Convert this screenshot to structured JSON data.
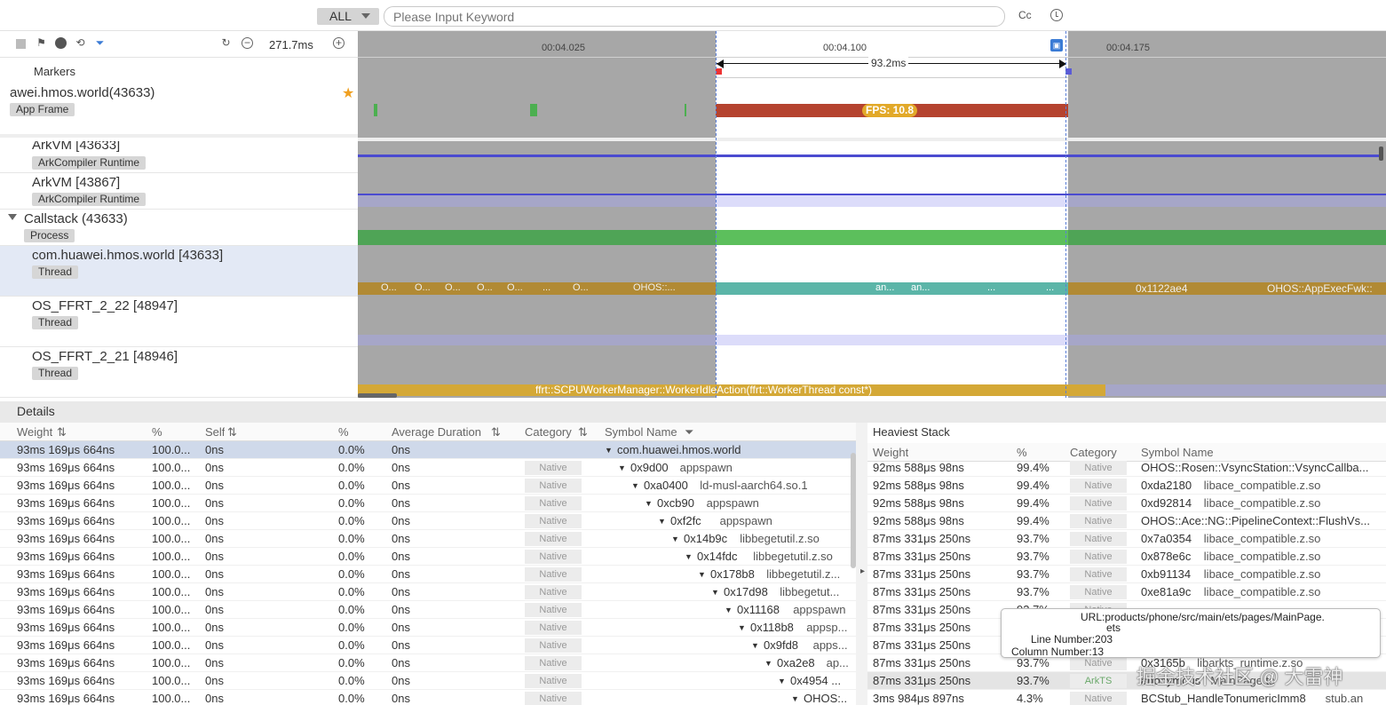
{
  "toolbar": {
    "filter_select": "ALL",
    "search_placeholder": "Please Input Keyword",
    "case_label": "Cc"
  },
  "left_toolbar": {
    "zoom_value": "271.7ms",
    "markers_label": "Markers"
  },
  "timeline": {
    "ticks": [
      "00:04.025",
      "00:04.100",
      "00:04.175"
    ],
    "selection_duration": "93.2ms",
    "fps_label": "FPS: 10.8",
    "thread_slices": [
      "O...",
      "O...",
      "O...",
      "O...",
      "O...",
      "...",
      "O...",
      "OHOS::...",
      "an...",
      "an...",
      "...",
      "...",
      "0x1122ae4",
      "OHOS::AppExecFwk::"
    ],
    "worker_slice": "ffrt::SCPUWorkerManager::WorkerIdleAction(ffrt::WorkerThread const*)"
  },
  "rows": [
    {
      "name": "awei.hmos.world(43633)",
      "tag": "App Frame"
    },
    {
      "name": "ArkVM [43633]",
      "tag": "ArkCompiler Runtime"
    },
    {
      "name": "ArkVM [43867]",
      "tag": "ArkCompiler Runtime"
    },
    {
      "name": "Callstack (43633)",
      "tag": "Process"
    },
    {
      "name": "com.huawei.hmos.world [43633]",
      "tag": "Thread"
    },
    {
      "name": "OS_FFRT_2_22 [48947]",
      "tag": "Thread"
    },
    {
      "name": "OS_FFRT_2_21 [48946]",
      "tag": "Thread"
    }
  ],
  "details": {
    "title": "Details",
    "columns": [
      "Weight",
      "%",
      "Self",
      "%",
      "Average Duration",
      "Category",
      "Symbol Name"
    ],
    "rows": [
      {
        "weight": "93ms 169μs 664ns",
        "pct": "100.0...",
        "self": "0ns",
        "spct": "0.0%",
        "avg": "0ns",
        "cat": "",
        "sym": "com.huawei.hmos.world",
        "lib": "",
        "indent": 0
      },
      {
        "weight": "93ms 169μs 664ns",
        "pct": "100.0...",
        "self": "0ns",
        "spct": "0.0%",
        "avg": "0ns",
        "cat": "Native",
        "sym": "0x9d00",
        "lib": "appspawn",
        "indent": 1
      },
      {
        "weight": "93ms 169μs 664ns",
        "pct": "100.0...",
        "self": "0ns",
        "spct": "0.0%",
        "avg": "0ns",
        "cat": "Native",
        "sym": "0xa0400",
        "lib": "ld-musl-aarch64.so.1",
        "indent": 2
      },
      {
        "weight": "93ms 169μs 664ns",
        "pct": "100.0...",
        "self": "0ns",
        "spct": "0.0%",
        "avg": "0ns",
        "cat": "Native",
        "sym": "0xcb90",
        "lib": "appspawn",
        "indent": 3
      },
      {
        "weight": "93ms 169μs 664ns",
        "pct": "100.0...",
        "self": "0ns",
        "spct": "0.0%",
        "avg": "0ns",
        "cat": "Native",
        "sym": "0xf2fc",
        "lib": "appspawn",
        "indent": 4
      },
      {
        "weight": "93ms 169μs 664ns",
        "pct": "100.0...",
        "self": "0ns",
        "spct": "0.0%",
        "avg": "0ns",
        "cat": "Native",
        "sym": "0x14b9c",
        "lib": "libbegetutil.z.so",
        "indent": 5
      },
      {
        "weight": "93ms 169μs 664ns",
        "pct": "100.0...",
        "self": "0ns",
        "spct": "0.0%",
        "avg": "0ns",
        "cat": "Native",
        "sym": "0x14fdc",
        "lib": "libbegetutil.z.so",
        "indent": 6
      },
      {
        "weight": "93ms 169μs 664ns",
        "pct": "100.0...",
        "self": "0ns",
        "spct": "0.0%",
        "avg": "0ns",
        "cat": "Native",
        "sym": "0x178b8",
        "lib": "libbegetutil.z...",
        "indent": 7
      },
      {
        "weight": "93ms 169μs 664ns",
        "pct": "100.0...",
        "self": "0ns",
        "spct": "0.0%",
        "avg": "0ns",
        "cat": "Native",
        "sym": "0x17d98",
        "lib": "libbegetut...",
        "indent": 8
      },
      {
        "weight": "93ms 169μs 664ns",
        "pct": "100.0...",
        "self": "0ns",
        "spct": "0.0%",
        "avg": "0ns",
        "cat": "Native",
        "sym": "0x11168",
        "lib": "appspawn",
        "indent": 9
      },
      {
        "weight": "93ms 169μs 664ns",
        "pct": "100.0...",
        "self": "0ns",
        "spct": "0.0%",
        "avg": "0ns",
        "cat": "Native",
        "sym": "0x118b8",
        "lib": "appsp...",
        "indent": 10
      },
      {
        "weight": "93ms 169μs 664ns",
        "pct": "100.0...",
        "self": "0ns",
        "spct": "0.0%",
        "avg": "0ns",
        "cat": "Native",
        "sym": "0x9fd8",
        "lib": "apps...",
        "indent": 11
      },
      {
        "weight": "93ms 169μs 664ns",
        "pct": "100.0...",
        "self": "0ns",
        "spct": "0.0%",
        "avg": "0ns",
        "cat": "Native",
        "sym": "0xa2e8",
        "lib": "ap...",
        "indent": 12
      },
      {
        "weight": "93ms 169μs 664ns",
        "pct": "100.0...",
        "self": "0ns",
        "spct": "0.0%",
        "avg": "0ns",
        "cat": "Native",
        "sym": "0x4954 ...",
        "lib": "",
        "indent": 13
      },
      {
        "weight": "93ms 169μs 664ns",
        "pct": "100.0...",
        "self": "0ns",
        "spct": "0.0%",
        "avg": "0ns",
        "cat": "Native",
        "sym": "OHOS:...",
        "lib": "",
        "indent": 14
      }
    ]
  },
  "heaviest": {
    "title": "Heaviest Stack",
    "columns": [
      "Weight",
      "%",
      "Category",
      "Symbol Name"
    ],
    "rows": [
      {
        "weight": "92ms 588μs 98ns",
        "pct": "99.4%",
        "cat": "Native",
        "sym": "OHOS::Rosen::VsyncStation::VsyncCallba...",
        "lib": ""
      },
      {
        "weight": "92ms 588μs 98ns",
        "pct": "99.4%",
        "cat": "Native",
        "sym": "0xda2180",
        "lib": "libace_compatible.z.so"
      },
      {
        "weight": "92ms 588μs 98ns",
        "pct": "99.4%",
        "cat": "Native",
        "sym": "0xd92814",
        "lib": "libace_compatible.z.so"
      },
      {
        "weight": "92ms 588μs 98ns",
        "pct": "99.4%",
        "cat": "Native",
        "sym": "OHOS::Ace::NG::PipelineContext::FlushVs...",
        "lib": ""
      },
      {
        "weight": "87ms 331μs 250ns",
        "pct": "93.7%",
        "cat": "Native",
        "sym": "0x7a0354",
        "lib": "libace_compatible.z.so"
      },
      {
        "weight": "87ms 331μs 250ns",
        "pct": "93.7%",
        "cat": "Native",
        "sym": "0x878e6c",
        "lib": "libace_compatible.z.so"
      },
      {
        "weight": "87ms 331μs 250ns",
        "pct": "93.7%",
        "cat": "Native",
        "sym": "0xb91134",
        "lib": "libace_compatible.z.so"
      },
      {
        "weight": "87ms 331μs 250ns",
        "pct": "93.7%",
        "cat": "Native",
        "sym": "0xe81a9c",
        "lib": "libace_compatible.z.so"
      },
      {
        "weight": "87ms 331μs 250ns",
        "pct": "93.7%",
        "cat": "Native",
        "sym": "",
        "lib": ""
      },
      {
        "weight": "87ms 331μs 250ns",
        "pct": "93.7%",
        "cat": "Native",
        "sym": "",
        "lib": ""
      },
      {
        "weight": "87ms 331μs 250ns",
        "pct": "93.7%",
        "cat": "Native",
        "sym": "",
        "lib": ""
      },
      {
        "weight": "87ms 331μs 250ns",
        "pct": "93.7%",
        "cat": "Native",
        "sym": "0x3165b",
        "lib": "libarkts_runtime.z.so"
      },
      {
        "weight": "87ms 331μs 250ns",
        "pct": "93.7%",
        "cat": "ArkTS",
        "sym": "anonymous",
        "lib": "MainPage.ts"
      },
      {
        "weight": "3ms 984μs 897ns",
        "pct": "4.3%",
        "cat": "Native",
        "sym": "BCStub_HandleTonumericImm8",
        "lib": "stub.an"
      }
    ]
  },
  "tooltip": {
    "url_label": "URL:",
    "url": "products/phone/src/main/ets/pages/MainPage.",
    "url2": "ets",
    "line_label": "Line Number:",
    "line": "203",
    "col_label": "Column Number:",
    "col": "13"
  },
  "watermark": "掘金技术社区 @ 大雷神",
  "colors": {
    "accent": "#5b5bd6",
    "fps_bar": "#b5432f",
    "fps_label": "#e2a929",
    "green": "#5cb85c",
    "thread": "#c49a3c",
    "teal": "#5bb5a8"
  }
}
